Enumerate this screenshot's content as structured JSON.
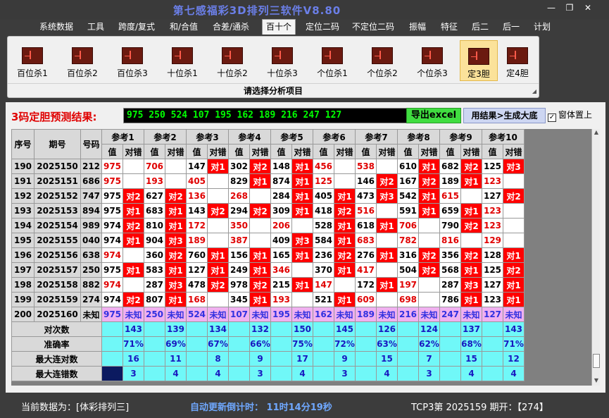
{
  "window": {
    "title": "第七感福彩3D排列三软件V8.80",
    "minimize": "—",
    "restore": "❐",
    "close": "✕"
  },
  "menu": [
    "系统数据",
    "工具",
    "跨度/复式",
    "和/合值",
    "合差/通杀",
    "百十个",
    "定位二码",
    "不定位二码",
    "振幅",
    "特征",
    "后二",
    "后一",
    "计划"
  ],
  "menu_active": "百十个",
  "ribbon": {
    "buttons": [
      "百位杀1",
      "百位杀2",
      "百位杀3",
      "十位杀1",
      "十位杀2",
      "十位杀3",
      "个位杀1",
      "个位杀2",
      "个位杀3",
      "定3胆",
      "定4胆"
    ],
    "selected": "定3胆",
    "caption": "请选择分析项目"
  },
  "result": {
    "label": "3码定胆预测结果:",
    "value": "975 250 524 107 195 162 189 216 247 127",
    "excel_button": "导出excel",
    "draw_button": "用结果>生成大底",
    "ontop_label": "窗体置上",
    "ontop_checked": "✓"
  },
  "table": {
    "headers": {
      "seq": "序号",
      "period": "期号",
      "number": "号码",
      "val": "值",
      "check": "对错"
    },
    "refs": [
      "参考1",
      "参考2",
      "参考3",
      "参考4",
      "参考5",
      "参考6",
      "参考7",
      "参考8",
      "参考9",
      "参考10"
    ],
    "rows": [
      {
        "seq": "190",
        "period": "2025150",
        "num": "212",
        "refs": [
          [
            "975",
            ""
          ],
          [
            "706",
            ""
          ],
          [
            "147",
            "对1"
          ],
          [
            "302",
            "对2"
          ],
          [
            "148",
            "对1"
          ],
          [
            "456",
            ""
          ],
          [
            "538",
            ""
          ],
          [
            "610",
            "对1"
          ],
          [
            "682",
            "对2"
          ],
          [
            "125",
            "对3"
          ]
        ]
      },
      {
        "seq": "191",
        "period": "2025151",
        "num": "686",
        "refs": [
          [
            "975",
            ""
          ],
          [
            "193",
            ""
          ],
          [
            "405",
            ""
          ],
          [
            "829",
            "对1"
          ],
          [
            "874",
            "对1"
          ],
          [
            "125",
            ""
          ],
          [
            "146",
            "对2"
          ],
          [
            "167",
            "对2"
          ],
          [
            "189",
            "对1"
          ],
          [
            "123",
            ""
          ]
        ]
      },
      {
        "seq": "192",
        "period": "2025152",
        "num": "747",
        "refs": [
          [
            "975",
            "对2"
          ],
          [
            "627",
            "对2"
          ],
          [
            "136",
            ""
          ],
          [
            "268",
            ""
          ],
          [
            "284",
            "对1"
          ],
          [
            "405",
            "对1"
          ],
          [
            "473",
            "对3"
          ],
          [
            "542",
            "对1"
          ],
          [
            "615",
            ""
          ],
          [
            "127",
            "对2"
          ]
        ]
      },
      {
        "seq": "193",
        "period": "2025153",
        "num": "894",
        "refs": [
          [
            "975",
            "对1"
          ],
          [
            "683",
            "对1"
          ],
          [
            "143",
            "对2"
          ],
          [
            "294",
            "对2"
          ],
          [
            "309",
            "对1"
          ],
          [
            "418",
            "对2"
          ],
          [
            "516",
            ""
          ],
          [
            "591",
            "对1"
          ],
          [
            "659",
            "对1"
          ],
          [
            "123",
            ""
          ]
        ]
      },
      {
        "seq": "194",
        "period": "2025154",
        "num": "989",
        "refs": [
          [
            "974",
            "对2"
          ],
          [
            "810",
            "对1"
          ],
          [
            "172",
            ""
          ],
          [
            "350",
            ""
          ],
          [
            "206",
            ""
          ],
          [
            "528",
            "对1"
          ],
          [
            "618",
            "对1"
          ],
          [
            "706",
            ""
          ],
          [
            "790",
            "对2"
          ],
          [
            "123",
            ""
          ]
        ]
      },
      {
        "seq": "195",
        "period": "2025155",
        "num": "040",
        "refs": [
          [
            "974",
            "对1"
          ],
          [
            "904",
            "对3"
          ],
          [
            "189",
            ""
          ],
          [
            "387",
            ""
          ],
          [
            "409",
            "对3"
          ],
          [
            "584",
            "对1"
          ],
          [
            "683",
            ""
          ],
          [
            "782",
            ""
          ],
          [
            "816",
            ""
          ],
          [
            "129",
            ""
          ]
        ]
      },
      {
        "seq": "196",
        "period": "2025156",
        "num": "638",
        "refs": [
          [
            "974",
            ""
          ],
          [
            "360",
            "对2"
          ],
          [
            "760",
            "对1"
          ],
          [
            "156",
            "对1"
          ],
          [
            "165",
            "对1"
          ],
          [
            "236",
            "对2"
          ],
          [
            "276",
            "对1"
          ],
          [
            "316",
            "对2"
          ],
          [
            "356",
            "对2"
          ],
          [
            "128",
            "对1"
          ]
        ]
      },
      {
        "seq": "197",
        "period": "2025157",
        "num": "250",
        "refs": [
          [
            "975",
            "对1"
          ],
          [
            "583",
            "对1"
          ],
          [
            "127",
            "对1"
          ],
          [
            "249",
            "对1"
          ],
          [
            "346",
            ""
          ],
          [
            "370",
            "对1"
          ],
          [
            "417",
            ""
          ],
          [
            "504",
            "对2"
          ],
          [
            "568",
            "对1"
          ],
          [
            "125",
            "对2"
          ]
        ]
      },
      {
        "seq": "198",
        "period": "2025158",
        "num": "882",
        "refs": [
          [
            "974",
            ""
          ],
          [
            "287",
            "对3"
          ],
          [
            "478",
            "对2"
          ],
          [
            "978",
            "对2"
          ],
          [
            "215",
            "对1"
          ],
          [
            "147",
            ""
          ],
          [
            "172",
            "对1"
          ],
          [
            "197",
            ""
          ],
          [
            "287",
            "对3"
          ],
          [
            "127",
            "对1"
          ]
        ]
      },
      {
        "seq": "199",
        "period": "2025159",
        "num": "274",
        "refs": [
          [
            "974",
            "对2"
          ],
          [
            "807",
            "对1"
          ],
          [
            "168",
            ""
          ],
          [
            "345",
            "对1"
          ],
          [
            "193",
            ""
          ],
          [
            "521",
            "对1"
          ],
          [
            "609",
            ""
          ],
          [
            "698",
            ""
          ],
          [
            "786",
            "对1"
          ],
          [
            "123",
            "对1"
          ]
        ]
      }
    ],
    "red_values": [
      [
        true,
        true,
        false,
        false,
        false,
        true,
        true,
        false,
        false,
        false
      ],
      [
        true,
        true,
        true,
        false,
        false,
        true,
        false,
        false,
        false,
        true
      ],
      [
        false,
        false,
        true,
        true,
        false,
        false,
        false,
        false,
        true,
        false
      ],
      [
        false,
        false,
        false,
        false,
        false,
        false,
        true,
        false,
        false,
        true
      ],
      [
        false,
        false,
        true,
        true,
        true,
        false,
        false,
        true,
        false,
        true
      ],
      [
        false,
        false,
        true,
        true,
        false,
        false,
        true,
        true,
        true,
        true
      ],
      [
        true,
        false,
        false,
        false,
        false,
        false,
        false,
        false,
        false,
        false
      ],
      [
        false,
        false,
        false,
        false,
        true,
        false,
        true,
        false,
        false,
        false
      ],
      [
        true,
        false,
        false,
        false,
        false,
        true,
        false,
        true,
        false,
        false
      ],
      [
        false,
        false,
        true,
        false,
        true,
        false,
        true,
        true,
        false,
        false
      ]
    ],
    "prediction_row": {
      "seq": "200",
      "period": "2025160",
      "num": "未知",
      "values": [
        "975",
        "250",
        "524",
        "107",
        "195",
        "162",
        "189",
        "216",
        "247",
        "127"
      ],
      "status": "未知"
    },
    "stats": [
      {
        "label": "对次数",
        "values": [
          "143",
          "139",
          "134",
          "132",
          "150",
          "145",
          "126",
          "124",
          "137",
          "143"
        ]
      },
      {
        "label": "准确率",
        "values": [
          "71%",
          "69%",
          "67%",
          "66%",
          "75%",
          "72%",
          "63%",
          "62%",
          "68%",
          "71%"
        ]
      },
      {
        "label": "最大连对数",
        "values": [
          "16",
          "11",
          "8",
          "9",
          "17",
          "9",
          "15",
          "7",
          "15",
          "12"
        ]
      },
      {
        "label": "最大连错数",
        "values": [
          "3",
          "4",
          "4",
          "3",
          "4",
          "3",
          "4",
          "3",
          "4",
          "4"
        ]
      }
    ]
  },
  "status": {
    "source": "当前数据为：[体彩排列三]",
    "countdown": "自动更新倒计时： 11时14分19秒",
    "draw": "TCP3第 2025159 期开：【274】"
  }
}
